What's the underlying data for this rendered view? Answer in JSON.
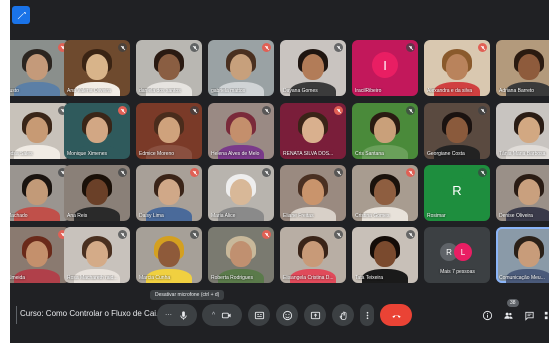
{
  "meeting": {
    "title": "Curso: Como Controlar o Fluxo de Cai..."
  },
  "tooltip": "Desativar microfone (ctrl + d)",
  "participant_count": "38",
  "more": {
    "label": "Mais 7 pessoas",
    "avatars": [
      "R",
      "L"
    ]
  },
  "participants": [
    {
      "name": "Justo",
      "type": "video",
      "bg": "#8a8f8c",
      "skin": "#c49a7a",
      "hair": "#2b2520",
      "shirt": "#5b7fa6"
    },
    {
      "name": "Ana Valeria Oliveira",
      "type": "video",
      "bg": "#6e4a2e",
      "skin": "#d8b48a",
      "hair": "#3a2414",
      "shirt": "#f2ede6"
    },
    {
      "name": "daniela dos santos",
      "type": "video",
      "bg": "#b9b7b2",
      "skin": "#8a5e42",
      "hair": "#2a1a12",
      "shirt": "#e6e4e0"
    },
    {
      "name": "gabriela mattos",
      "type": "video",
      "bg": "#9aa2a4",
      "skin": "#c7a07c",
      "hair": "#4a3020",
      "shirt": "#d0d4d6"
    },
    {
      "name": "Dayana Gomes",
      "type": "video",
      "bg": "#c9c4c0",
      "skin": "#b27c58",
      "hair": "#1f1510",
      "shirt": "#3b3b3b"
    },
    {
      "name": "IracilRibeiro",
      "type": "initial",
      "bg": "#c2185b",
      "initial": "I",
      "circle": "#e91e63"
    },
    {
      "name": "Alexandra e da silva",
      "type": "video",
      "bg": "#d9c8b0",
      "skin": "#b9835c",
      "hair": "#8a5a2c",
      "shirt": "#d04040"
    },
    {
      "name": "Adriana Barreto",
      "type": "video",
      "bg": "#b39a7c",
      "skin": "#8e5b3c",
      "hair": "#2a1a10",
      "shirt": "#3a3a3a"
    },
    {
      "name": "Jidsa Sales",
      "type": "video",
      "bg": "#c8c2ba",
      "skin": "#c79a74",
      "hair": "#3a2618",
      "shirt": "#f0ebe4"
    },
    {
      "name": "Monique Ximenes",
      "type": "video",
      "bg": "#2f5a5c",
      "skin": "#d2a784",
      "hair": "#3a2618",
      "shirt": "#2f5a5c"
    },
    {
      "name": "Edmice Moreno",
      "type": "video",
      "bg": "#7a3a28",
      "skin": "#cfa27c",
      "hair": "#4a2c1c",
      "shirt": "#8a5040"
    },
    {
      "name": "Helena Alves de Melo",
      "type": "video",
      "bg": "#9a8a84",
      "skin": "#c48f6c",
      "hair": "#7a2a3a",
      "shirt": "#7a3a8a"
    },
    {
      "name": "RENATA SILVA DOS...",
      "type": "video",
      "bg": "#7a1e3a",
      "skin": "#d9b08e",
      "hair": "#3a2418",
      "shirt": "#7a1e3a"
    },
    {
      "name": "Cris Santana",
      "type": "video",
      "bg": "#4a8a3a",
      "skin": "#c9a07a",
      "hair": "#2a1c12",
      "shirt": "#6aa05a"
    },
    {
      "name": "Georgiane Costa",
      "type": "video",
      "bg": "#5a4a40",
      "skin": "#8a5a3c",
      "hair": "#1a1210",
      "shirt": "#222222"
    },
    {
      "name": "Tânia Maria Barbosa",
      "type": "video",
      "bg": "#c8c4c0",
      "skin": "#d2a882",
      "hair": "#2a1c14",
      "shirt": "#e0dcd8"
    },
    {
      "name": "Machado",
      "type": "video",
      "bg": "#9a9590",
      "skin": "#c29a78",
      "hair": "#1a1410",
      "shirt": "#c0504a"
    },
    {
      "name": "Ana Reis",
      "type": "video",
      "bg": "#8a8078",
      "skin": "#6a4028",
      "hair": "#1a1008",
      "shirt": "#2a2a2a"
    },
    {
      "name": "Daisy Lima",
      "type": "video",
      "bg": "#a8a098",
      "skin": "#d0a888",
      "hair": "#3a2418",
      "shirt": "#4a6a9a"
    },
    {
      "name": "Maria Alice",
      "type": "video",
      "bg": "#b8b4ae",
      "skin": "#d8b898",
      "hair": "#eeeeee",
      "shirt": "#8a8a8a"
    },
    {
      "name": "Eliane Freitas",
      "type": "video",
      "bg": "#9a8a80",
      "skin": "#c9946c",
      "hair": "#4a3022",
      "shirt": "#d8d0c8"
    },
    {
      "name": "Cristina Gomes",
      "type": "video",
      "bg": "#a89c90",
      "skin": "#8e5e40",
      "hair": "#1a120c",
      "shirt": "#e8e2da"
    },
    {
      "name": "Rosimar",
      "type": "initial",
      "bg": "#1e8e3e",
      "initial": "R",
      "circle": "#1e8e3e"
    },
    {
      "name": "Denise Oliveira",
      "type": "video",
      "bg": "#9a9088",
      "skin": "#c9a07e",
      "hair": "#2a1c14",
      "shirt": "#3a3a4a"
    },
    {
      "name": "Almeida",
      "type": "video",
      "bg": "#8a7a70",
      "skin": "#c4906c",
      "hair": "#6a2a1a",
      "shirt": "#b0404a"
    },
    {
      "name": "Rosa Machareth raid...",
      "type": "video",
      "bg": "#c8c2bc",
      "skin": "#d4ab88",
      "hair": "#4a3020",
      "shirt": "#e8e2dc"
    },
    {
      "name": "Marcia Cunha",
      "type": "video",
      "bg": "#a6a098",
      "skin": "#8e5a3a",
      "hair": "#d4a020",
      "shirt": "#f0d040"
    },
    {
      "name": "Roberta Rodrigues",
      "type": "video",
      "bg": "#7a7a70",
      "skin": "#c09070",
      "hair": "#c8b89a",
      "shirt": "#5a7a4a"
    },
    {
      "name": "Elisangela Cristina D...",
      "type": "video",
      "bg": "#b8aea4",
      "skin": "#c89a78",
      "hair": "#3a2418",
      "shirt": "#e04a5a"
    },
    {
      "name": "Tata Teixeira",
      "type": "video",
      "bg": "#c8c0b8",
      "skin": "#7a4a2e",
      "hair": "#140c08",
      "shirt": "#1a1a1a"
    },
    {
      "name": "Comunicação Meu...",
      "type": "video",
      "bg": "#8a9aa8",
      "skin": "#c89c7a",
      "hair": "#2a2018",
      "shirt": "#4a5a7a",
      "active": true
    }
  ]
}
